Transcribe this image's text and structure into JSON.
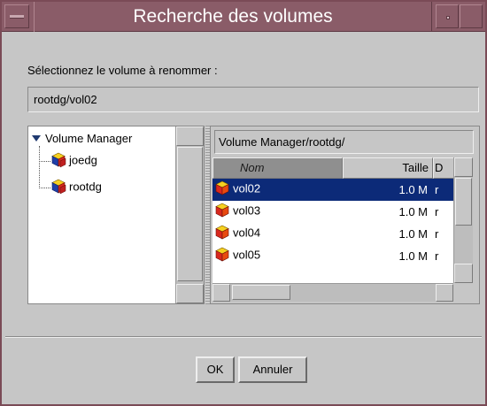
{
  "window": {
    "title": "Recherche des volumes"
  },
  "dialog": {
    "prompt": "Sélectionnez le volume à renommer :",
    "selected_path": "rootdg/vol02"
  },
  "tree": {
    "root_label": "Volume Manager",
    "children": [
      {
        "label": "joedg",
        "icon": "disk-group-icon"
      },
      {
        "label": "rootdg",
        "icon": "disk-group-icon"
      }
    ]
  },
  "table": {
    "current_path": "Volume Manager/rootdg/",
    "columns": [
      "Nom",
      "Taille",
      "D"
    ],
    "rows": [
      {
        "name": "vol02",
        "size": "1.0 M",
        "desc": "r",
        "selected": true
      },
      {
        "name": "vol03",
        "size": "1.0 M",
        "desc": "r",
        "selected": false
      },
      {
        "name": "vol04",
        "size": "1.0 M",
        "desc": "r",
        "selected": false
      },
      {
        "name": "vol05",
        "size": "1.0 M",
        "desc": "r",
        "selected": false
      }
    ]
  },
  "buttons": {
    "ok": "OK",
    "cancel": "Annuler"
  },
  "colors": {
    "titlebar": "#8a5c68",
    "selection": "#0c2a78",
    "window_bg": "#c6c6c6"
  }
}
